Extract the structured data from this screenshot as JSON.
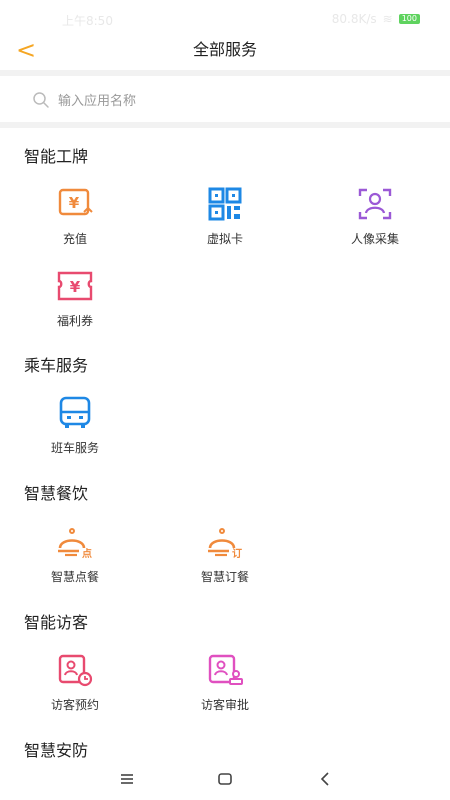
{
  "status_bar": {
    "time": "上午8:50",
    "network": "80.8K/s",
    "battery": "100"
  },
  "header": {
    "title": "全部服务",
    "back_symbol": "<"
  },
  "search": {
    "placeholder": "输入应用名称"
  },
  "sections": [
    {
      "title": "智能工牌",
      "items": [
        {
          "label": "充值",
          "icon": "recharge-icon"
        },
        {
          "label": "虚拟卡",
          "icon": "qr-code-icon"
        },
        {
          "label": "人像采集",
          "icon": "face-capture-icon"
        },
        {
          "label": "福利券",
          "icon": "coupon-icon"
        }
      ]
    },
    {
      "title": "乘车服务",
      "items": [
        {
          "label": "班车服务",
          "icon": "bus-icon"
        }
      ]
    },
    {
      "title": "智慧餐饮",
      "items": [
        {
          "label": "智慧点餐",
          "icon": "order-food-icon",
          "badge": "点"
        },
        {
          "label": "智慧订餐",
          "icon": "book-meal-icon",
          "badge": "订"
        }
      ]
    },
    {
      "title": "智能访客",
      "items": [
        {
          "label": "访客预约",
          "icon": "visitor-appointment-icon"
        },
        {
          "label": "访客审批",
          "icon": "visitor-approval-icon"
        }
      ]
    },
    {
      "title": "智慧安防",
      "items": []
    }
  ],
  "colors": {
    "accent": "#f5a623",
    "orange": "#f08a3c",
    "blue": "#1e88e5",
    "purple": "#9b59d6",
    "pink": "#e84a6f",
    "magenta": "#e050c0"
  }
}
